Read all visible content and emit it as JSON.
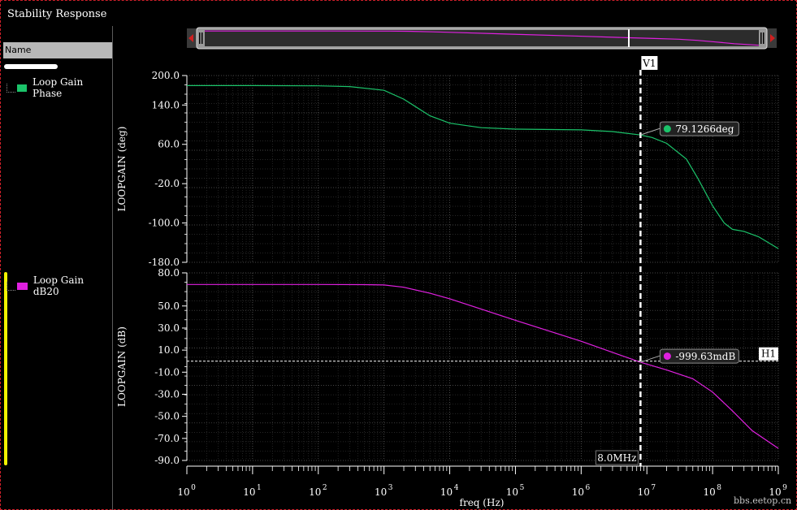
{
  "window": {
    "title": "Stability Response"
  },
  "legend": {
    "header": "Name",
    "items": [
      {
        "label": "Loop Gain Phase",
        "color": "#1bc36a"
      },
      {
        "label": "Loop Gain dB20",
        "color": "#e020e0"
      }
    ]
  },
  "cursors": {
    "vertical": {
      "name": "V1",
      "x_hz": 8000000,
      "label": "8.0MHz"
    },
    "horizontal": {
      "name": "H1",
      "y_db": 0
    },
    "markers": [
      {
        "series": "Loop Gain Phase",
        "label": "79.1266deg",
        "x_hz": 8000000,
        "y": 79.1266,
        "color": "#1bc36a"
      },
      {
        "series": "Loop Gain dB20",
        "label": "-999.63mdB",
        "x_hz": 8000000,
        "y": -0.99963,
        "color": "#e020e0"
      }
    ]
  },
  "watermark": "bbs.eetop.cn",
  "chart_data": [
    {
      "type": "line",
      "xlabel": "freq (Hz)",
      "ylabel": "LOOPGAIN (deg)",
      "xscale": "log",
      "xlim": [
        1,
        1000000000
      ],
      "xticks": [
        1,
        10,
        100,
        1000,
        10000,
        100000,
        1000000,
        10000000,
        100000000,
        1000000000
      ],
      "xtick_labels": [
        "10",
        "10",
        "10",
        "10",
        "10",
        "10",
        "10",
        "10",
        "10",
        "10"
      ],
      "xtick_exponents": [
        "0",
        "1",
        "2",
        "3",
        "4",
        "5",
        "6",
        "7",
        "8",
        "9"
      ],
      "ylim": [
        -180,
        200
      ],
      "yticks": [
        200,
        140,
        60,
        -20,
        -100,
        -180
      ],
      "ytick_labels": [
        "200.0",
        "140.0",
        "60.0",
        "-20.0",
        "-100.0",
        "-180.0"
      ],
      "grid": true,
      "series": [
        {
          "name": "Loop Gain Phase",
          "color": "#1bc36a",
          "x": [
            1,
            10,
            100,
            300,
            1000,
            2000,
            5000,
            10000,
            30000,
            100000,
            1000000,
            3000000,
            8000000,
            12000000,
            20000000,
            40000000,
            60000000,
            100000000,
            150000000,
            200000000,
            300000000,
            500000000,
            1000000000
          ],
          "y": [
            179.5,
            179.5,
            179,
            177.5,
            170,
            152,
            118,
            103,
            94,
            91,
            89.5,
            86,
            79.1,
            74,
            62,
            30,
            -10,
            -65,
            -100,
            -113,
            -117,
            -128,
            -152
          ]
        }
      ]
    },
    {
      "type": "line",
      "xlabel": "freq (Hz)",
      "ylabel": "LOOPGAIN (dB)",
      "xscale": "log",
      "xlim": [
        1,
        1000000000
      ],
      "xticks": [
        1,
        10,
        100,
        1000,
        10000,
        100000,
        1000000,
        10000000,
        100000000,
        1000000000
      ],
      "xtick_labels": [
        "10",
        "10",
        "10",
        "10",
        "10",
        "10",
        "10",
        "10",
        "10",
        "10"
      ],
      "xtick_exponents": [
        "0",
        "1",
        "2",
        "3",
        "4",
        "5",
        "6",
        "7",
        "8",
        "9"
      ],
      "ylim": [
        -90,
        80
      ],
      "yticks": [
        80,
        50,
        30,
        10,
        -10,
        -30,
        -50,
        -70,
        -90
      ],
      "ytick_labels": [
        "80.0",
        "50.0",
        "30.0",
        "10.0",
        "-10.0",
        "-30.0",
        "-50.0",
        "-70.0",
        "-90.0"
      ],
      "grid": true,
      "series": [
        {
          "name": "Loop Gain dB20",
          "color": "#e020e0",
          "x": [
            1,
            10,
            100,
            500,
            1000,
            2000,
            5000,
            10000,
            100000,
            1000000,
            8000000,
            20000000,
            50000000,
            100000000,
            200000000,
            400000000,
            1000000000
          ],
          "y": [
            69.5,
            69.5,
            69.5,
            69.3,
            69,
            67,
            61.5,
            56.5,
            37,
            18,
            -1,
            -8,
            -16,
            -28,
            -45,
            -63,
            -79
          ]
        }
      ]
    }
  ]
}
